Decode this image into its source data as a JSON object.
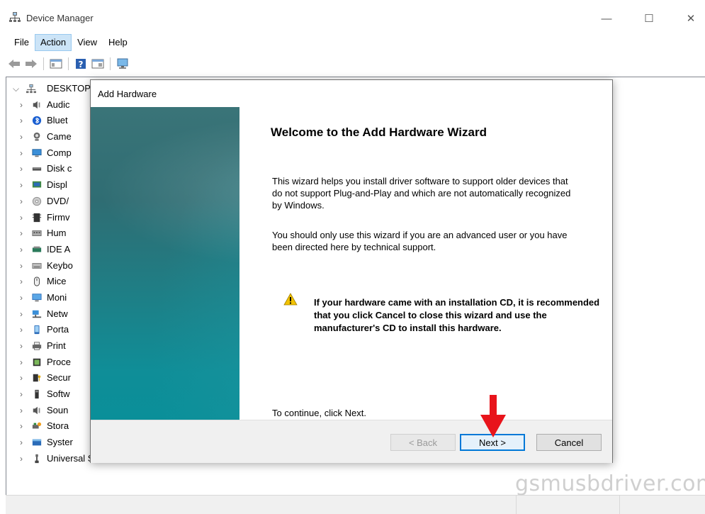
{
  "window": {
    "title": "Device Manager",
    "controls": {
      "minimize": "—",
      "maximize": "☐",
      "close": "✕"
    }
  },
  "menu": {
    "items": [
      "File",
      "Action",
      "View",
      "Help"
    ],
    "active": "Action"
  },
  "tree": {
    "root": "DESKTOP",
    "items": [
      {
        "label": "Audic",
        "icon": "speaker-icon"
      },
      {
        "label": "Bluet",
        "icon": "bluetooth-icon"
      },
      {
        "label": "Came",
        "icon": "camera-icon"
      },
      {
        "label": "Comp",
        "icon": "computer-icon"
      },
      {
        "label": "Disk c",
        "icon": "disk-drive-icon"
      },
      {
        "label": "Displ",
        "icon": "display-adapter-icon"
      },
      {
        "label": "DVD/",
        "icon": "dvd-drive-icon"
      },
      {
        "label": "Firmv",
        "icon": "firmware-icon"
      },
      {
        "label": "Hum",
        "icon": "hid-icon"
      },
      {
        "label": "IDE A",
        "icon": "ide-controller-icon"
      },
      {
        "label": "Keybo",
        "icon": "keyboard-icon"
      },
      {
        "label": "Mice",
        "icon": "mouse-icon"
      },
      {
        "label": "Moni",
        "icon": "monitor-icon"
      },
      {
        "label": "Netw",
        "icon": "network-adapter-icon"
      },
      {
        "label": "Porta",
        "icon": "portable-device-icon"
      },
      {
        "label": "Print",
        "icon": "printer-icon"
      },
      {
        "label": "Proce",
        "icon": "processor-icon"
      },
      {
        "label": "Secur",
        "icon": "security-device-icon"
      },
      {
        "label": "Softw",
        "icon": "software-device-icon"
      },
      {
        "label": "Soun",
        "icon": "sound-icon"
      },
      {
        "label": "Stora",
        "icon": "storage-controller-icon"
      },
      {
        "label": "Syster",
        "icon": "system-device-icon"
      },
      {
        "label": "Universal Serial Bus controllers",
        "icon": "usb-icon"
      }
    ]
  },
  "wizard": {
    "title": "Add Hardware",
    "heading": "Welcome to the Add Hardware Wizard",
    "para1": "This wizard helps you install driver software to support older devices that do not support Plug-and-Play and which are not automatically recognized by Windows.",
    "para2": "You should only use this wizard if you are an advanced user or you have been directed here by technical support.",
    "warning": "If your hardware came with an installation CD, it is recommended that you click Cancel to close this wizard and use the manufacturer's CD to install this hardware.",
    "continue_text": "To continue, click Next.",
    "buttons": {
      "back": "< Back",
      "next": "Next >",
      "cancel": "Cancel"
    }
  },
  "watermark": "gsmusbdriver.com",
  "colors": {
    "accent": "#0078d7",
    "arrow": "#e8141b",
    "banner": "#1e7f86"
  }
}
